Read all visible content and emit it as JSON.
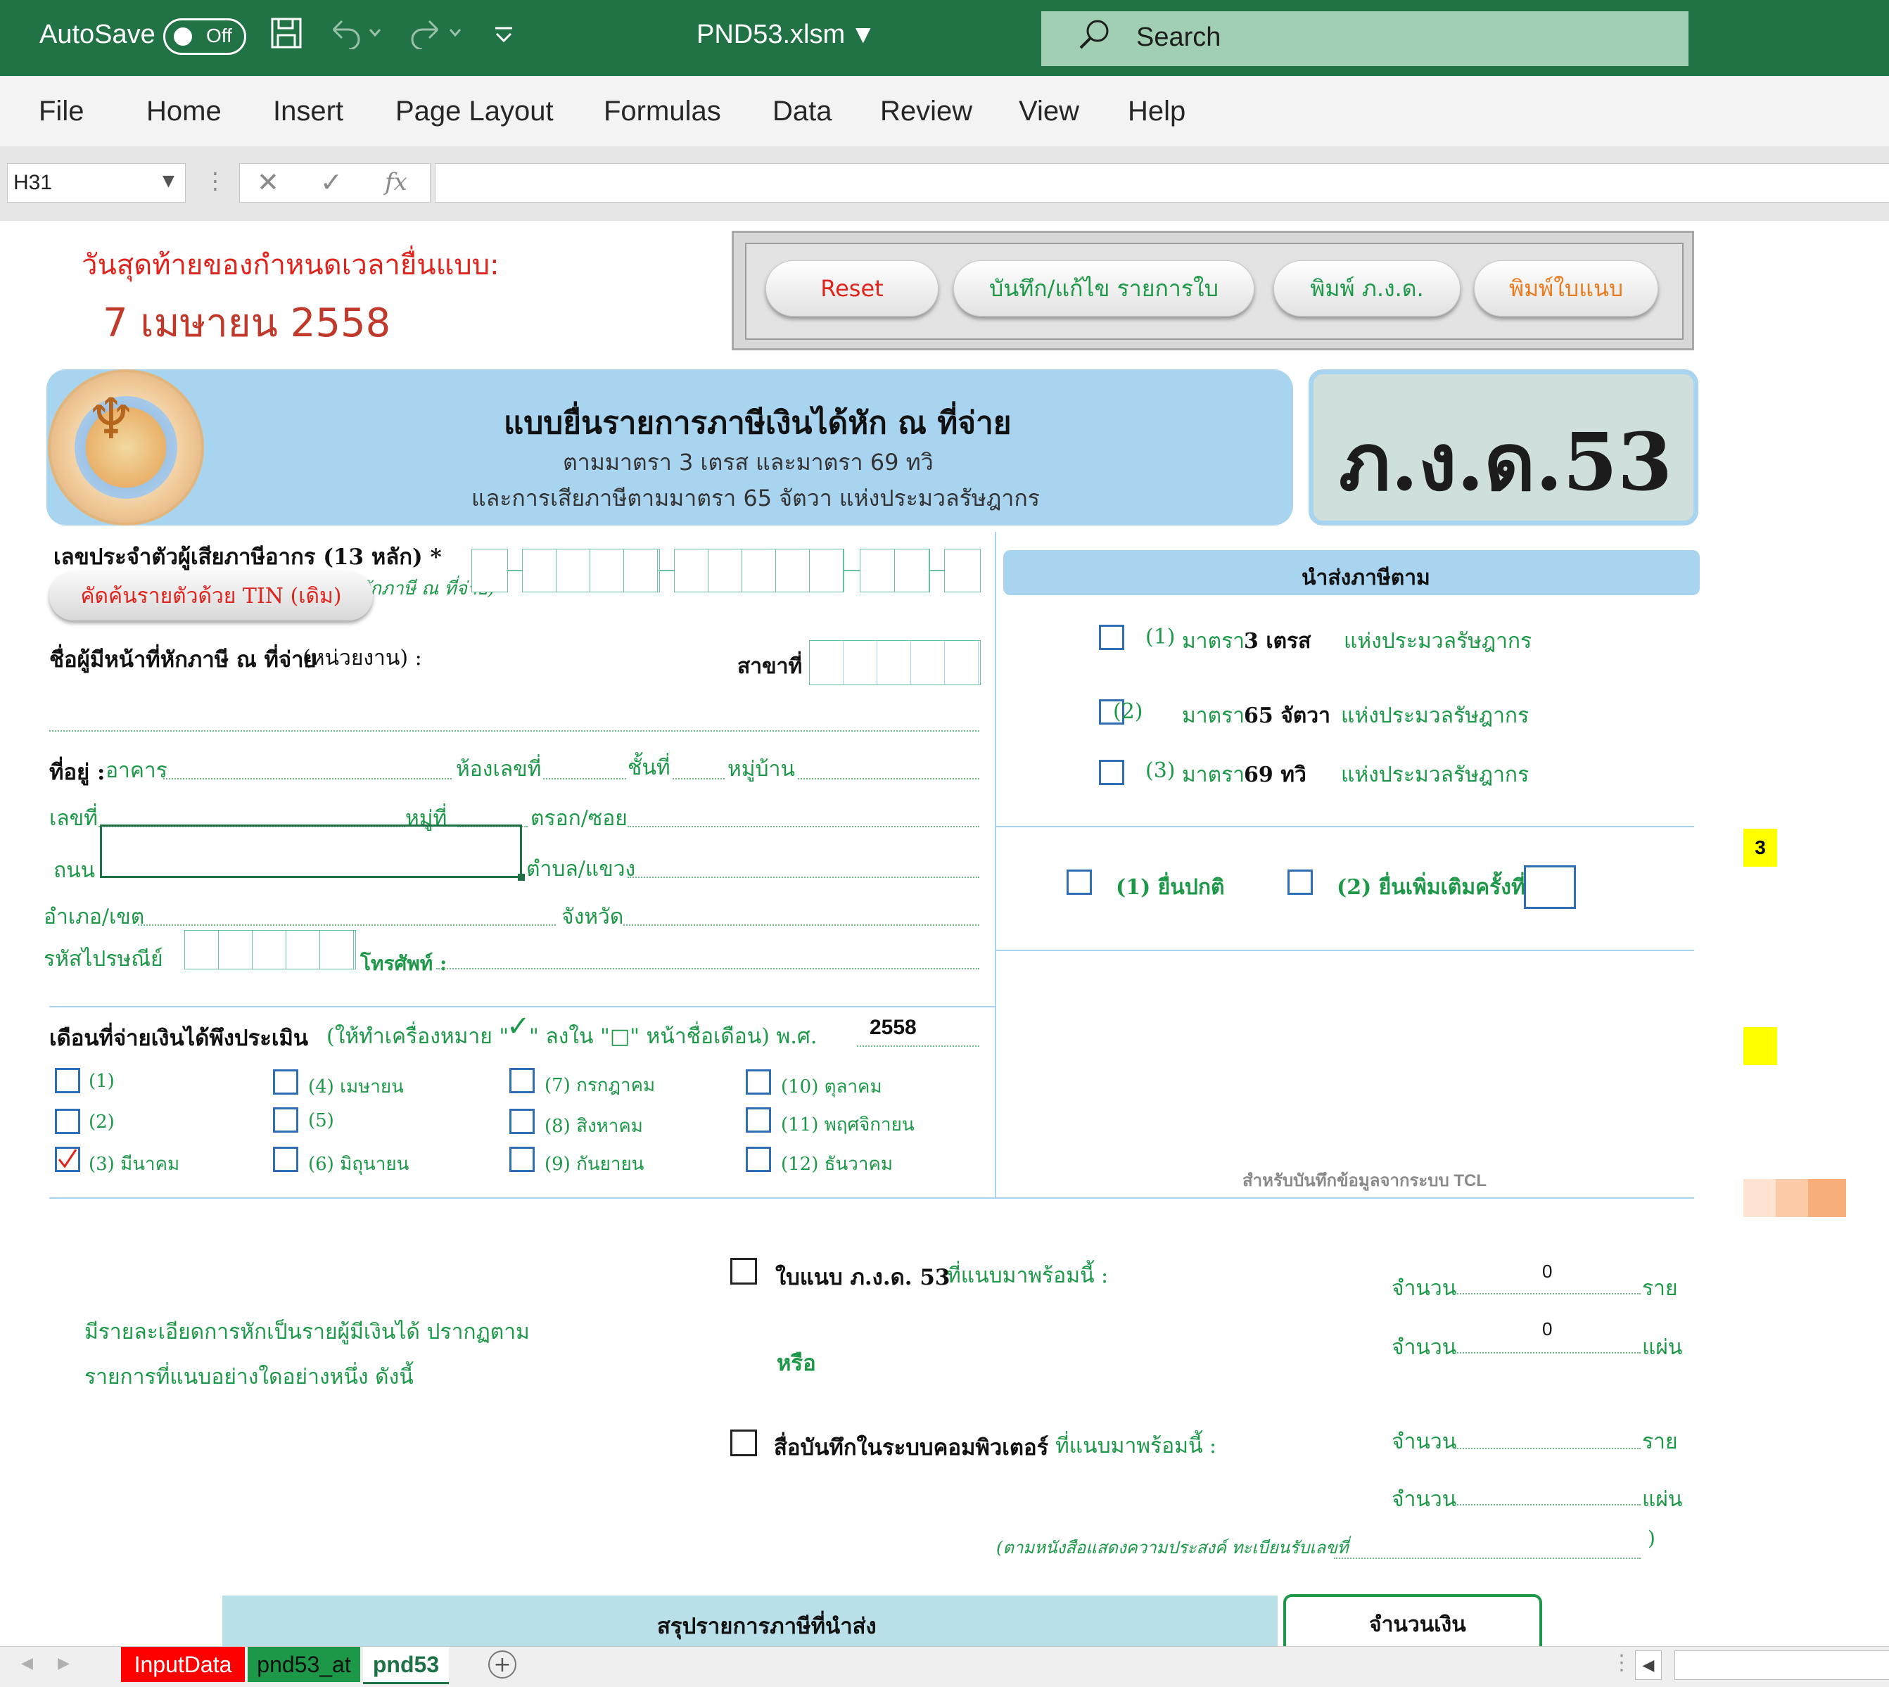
{
  "titlebar": {
    "autosave_label": "AutoSave",
    "autosave_state": "Off",
    "filename": "PND53.xlsm",
    "search_placeholder": "Search",
    "accent_color": "#217346"
  },
  "ribbon": {
    "tabs": [
      "File",
      "Home",
      "Insert",
      "Page Layout",
      "Formulas",
      "Data",
      "Review",
      "View",
      "Help"
    ]
  },
  "formula_bar": {
    "name_box": "H31",
    "fx": "fx",
    "value": ""
  },
  "sheet": {
    "deadline_label": "วันสุดท้ายของกำหนดเวลายื่นแบบ:",
    "deadline_date": "7 เมษายน 2558",
    "buttons": {
      "reset": "Reset",
      "save_edit": "บันทึก/แก้ไข รายการใบ",
      "print_form": "พิมพ์ ภ.ง.ด.",
      "print_attachment": "พิมพ์ใบแนบ"
    },
    "header": {
      "title": "แบบยื่นรายการภาษีเงินได้หัก ณ ที่จ่าย",
      "subtitle1": "ตามมาตรา 3 เตรส และมาตรา 69 ทวิ",
      "subtitle2": "และการเสียภาษีตามมาตรา 65 จัตวา แห่งประมวลรัษฎากร",
      "form_code": "ภ.ง.ด.53"
    },
    "taxpayer": {
      "tin_label": "เลขประจำตัวผู้เสียภาษีอากร (13 หลัก) *",
      "tin_hint": "ผู้มีหน้าที่หักภาษี ณ ที่จ่าย)",
      "tin_search_button": "คัดค้นรายตัวด้วย TIN (เดิม)",
      "payer_name_label": "ชื่อผู้มีหน้าที่หักภาษี ณ ที่จ่าย",
      "payer_name_suffix": "(หน่วยงาน) :",
      "branch_label": "สาขาที่",
      "address_label": "ที่อยู่ :",
      "building": "อาคาร",
      "room_no": "ห้องเลขที่",
      "floor": "ชั้นที่",
      "village": "หมู่บ้าน",
      "house_no": "เลขที่",
      "moo": "หมู่ที่",
      "soi": "ตรอก/ซอย",
      "road": "ถนน",
      "subdistrict": "ตำบล/แขวง",
      "district": "อำเภอ/เขต",
      "province": "จังหวัด",
      "postal_code": "รหัสไปรษณีย์",
      "phone": "โทรศัพท์ :"
    },
    "remit": {
      "title": "นำส่งภาษีตาม",
      "items": [
        {
          "num": "(1)",
          "law": "มาตรา",
          "section": "3 เตรส",
          "suffix": "แห่งประมวลรัษฎากร"
        },
        {
          "num": "(2)",
          "law": "มาตรา",
          "section": "65 จัตวา",
          "suffix": "แห่งประมวลรัษฎากร"
        },
        {
          "num": "(3)",
          "law": "มาตรา",
          "section": "69 ทวิ",
          "suffix": "แห่งประมวลรัษฎากร"
        }
      ],
      "normal_filing": "(1) ยื่นปกติ",
      "additional_filing": "(2) ยื่นเพิ่มเติมครั้งที่",
      "tcl_note": "สำหรับบันทึกข้อมูลจากระบบ TCL",
      "side_badge": "3"
    },
    "months": {
      "label": "เดือนที่จ่ายเงินได้พึงประเมิน",
      "instruction_a": "(ให้ทำเครื่องหมาย \"",
      "instruction_check": "✓",
      "instruction_b": "\" ลงใน \"□\" หน้าชื่อเดือน) พ.ศ.",
      "year": "2558",
      "items": [
        "(1)",
        "(2)",
        "(3) มีนาคม",
        "(4) เมษายน",
        "(5)",
        "(6) มิถุนายน",
        "(7) กรกฎาคม",
        "(8) สิงหาคม",
        "(9) กันยายน",
        "(10) ตุลาคม",
        "(11) พฤศจิกายน",
        "(12) ธันวาคม"
      ],
      "checked": "(3) มีนาคม"
    },
    "attachments": {
      "details_line1": "มีรายละเอียดการหักเป็นรายผู้มีเงินได้ ปรากฏตาม",
      "details_line2": "รายการที่แนบอย่างใดอย่างหนึ่ง ดังนี้",
      "attach_label": "ใบแนบ ภ.ง.ด. 53",
      "attach_suffix": "ที่แนบมาพร้อมนี้ :",
      "or": "หรือ",
      "media_label": "สื่อบันทึกในระบบคอมพิวเตอร์",
      "media_suffix": "ที่แนบมาพร้อมนี้ :",
      "count_label": "จำนวน",
      "persons_unit": "ราย",
      "sheets_unit": "แผ่น",
      "attach_persons": "0",
      "attach_sheets": "0",
      "registration_note": "(ตามหนังสือแสดงความประสงค์ ทะเบียนรับเลขที่",
      "close_paren": ")"
    },
    "summary": {
      "title": "สรุปรายการภาษีที่นำส่ง",
      "amount": "จำนวนเงิน"
    }
  },
  "sheet_tabs": [
    {
      "label": "InputData",
      "color": "#ff0000"
    },
    {
      "label": "pnd53_at",
      "color": "#1c9848"
    },
    {
      "label": "pnd53",
      "color": "#ffffff"
    }
  ]
}
